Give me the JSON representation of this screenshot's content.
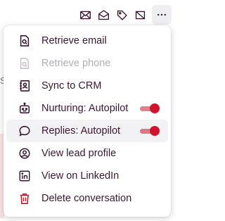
{
  "toolbar": {
    "icons": [
      "mail-icon",
      "mail-open-icon",
      "tag-icon",
      "archive-off-icon"
    ],
    "more_icon": "more-horizontal-icon"
  },
  "background": {
    "partial_letter": "S"
  },
  "menu": {
    "items": [
      {
        "label": "Retrieve email",
        "icon": "search-document-icon",
        "disabled": false
      },
      {
        "label": "Retrieve phone",
        "icon": "search-document-icon",
        "disabled": true
      },
      {
        "label": "Sync to CRM",
        "icon": "contact-card-icon",
        "disabled": false
      },
      {
        "label": "Nurturing: Autopilot",
        "icon": "robot-icon",
        "disabled": false,
        "toggle": true
      },
      {
        "label": "Replies: Autopilot",
        "icon": "chat-bubble-icon",
        "disabled": false,
        "toggle": true,
        "active": true
      },
      {
        "label": "View lead profile",
        "icon": "user-circle-icon",
        "disabled": false
      },
      {
        "label": "View on LinkedIn",
        "icon": "linkedin-icon",
        "disabled": false
      },
      {
        "label": "Delete conversation",
        "icon": "trash-icon",
        "disabled": false
      }
    ]
  },
  "colors": {
    "text": "#3b1632",
    "disabled_text": "#b5adb3",
    "toggle_on": "#d0142c",
    "delete_icon": "#d0142c"
  }
}
